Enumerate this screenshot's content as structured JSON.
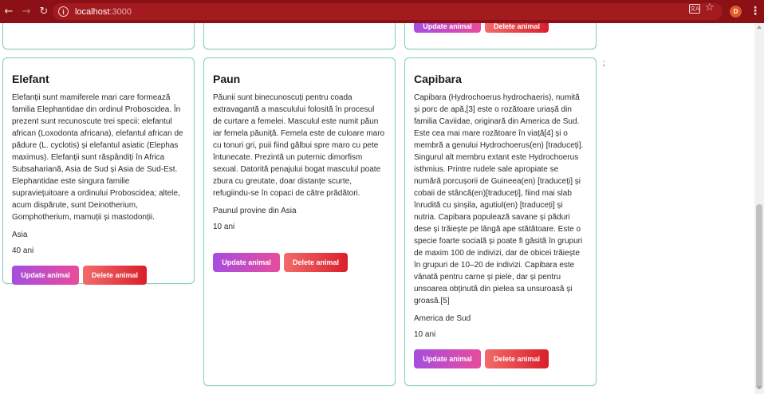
{
  "browser": {
    "url_host": "localhost",
    "url_port": ":3000",
    "back_glyph": "←",
    "forward_glyph": "→",
    "reload_glyph": "↻",
    "info_glyph": "i",
    "translate_glyph": "文A",
    "star_glyph": "☆",
    "avatar_letter": "D",
    "menu_glyph": "⋮"
  },
  "page": {
    "stray_text": ";",
    "update_label": "Update animal",
    "delete_label": "Delete animal"
  },
  "animals": [
    {
      "name": "Elefant",
      "description": "Elefanții sunt mamiferele mari care formează familia Elephantidae din ordinul Proboscidea. În prezent sunt recunoscute trei specii: elefantul african (Loxodonta africana), elefantul african de pădure (L. cyclotis) și elefantul asiatic (Elephas maximus). Elefanții sunt răspândiți în Africa Subsahariană, Asia de Sud și Asia de Sud-Est. Elephantidae este singura familie supraviețuitoare a ordinului Proboscidea; altele, acum dispărute, sunt Deinotherium, Gomphotherium, mamuții și mastodonții.",
      "origin": "Asia",
      "age": "40 ani"
    },
    {
      "name": "Paun",
      "description": "Păunii sunt binecunoscuți pentru coada extravagantă a masculului folosită în procesul de curtare a femelei. Masculul este numit păun iar femela păuniță. Femela este de culoare maro cu tonuri gri, puii fiind gălbui spre maro cu pete întunecate. Prezintă un puternic dimorfism sexual. Datorită penajului bogat masculul poate zbura cu greutate, doar distanțe scurte, refugiindu-se în copaci de către prădători.",
      "origin": "Paunul provine din Asia",
      "age": "10 ani"
    },
    {
      "name": "Capibara",
      "description": "Capibara (Hydrochoerus hydrochaeris), numită și porc de apă,[3] este o rozătoare uriașă din familia Caviidae, originară din America de Sud. Este cea mai mare rozătoare în viață[4] și o membră a genului Hydrochoerus(en) [traduceți]. Singurul alt membru extant este Hydrochoerus isthmius. Printre rudele sale apropiate se numără porcușorii de Guineea(en) [traduceți] și cobaii de stâncă(en)[traduceți], fiind mai slab înrudită cu șinșila, agutiul(en) [traduceți] și nutria. Capibara populează savane și păduri dese și trăiește pe lângă ape stătătoare. Este o specie foarte socială și poate fi găsită în grupuri de maxim 100 de indivizi, dar de obicei trăiește în grupuri de 10–20 de indivizi. Capibara este vânată pentru carne și piele, dar și pentru unsoarea obținută din pielea sa unsuroasă și groasă.[5]",
      "origin": "America de Sud",
      "age": "10 ani"
    }
  ]
}
